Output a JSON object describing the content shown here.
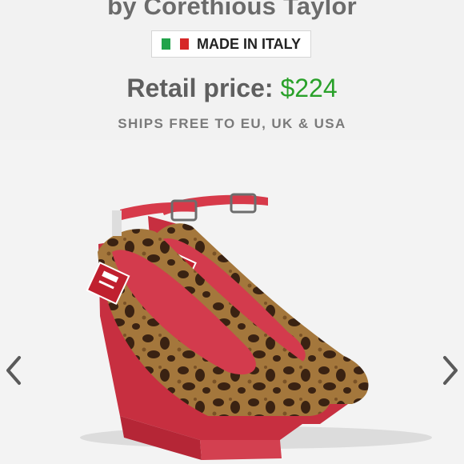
{
  "header": {
    "subtitle": "by Corethious Taylor",
    "origin_badge": "MADE IN ITALY",
    "price_label": "Retail price:",
    "price_value": "$224",
    "shipping_text": "SHIPS FREE TO EU, UK & USA"
  },
  "colors": {
    "flag_green": "#22a34a",
    "flag_white": "#ffffff",
    "flag_red": "#d62828",
    "price_green": "#2aa12a",
    "shoe_red": "#d73a4a",
    "leopard_base": "#a4773c",
    "leopard_spot": "#3a2212"
  },
  "gallery": {
    "prev_icon": "chevron-left-icon",
    "next_icon": "chevron-right-icon"
  }
}
